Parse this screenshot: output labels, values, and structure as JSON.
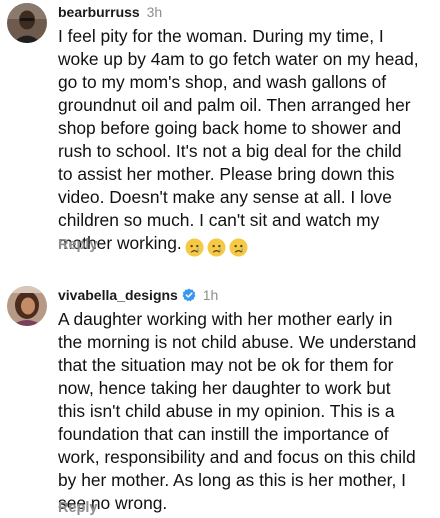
{
  "comments": [
    {
      "username": "bearburruss",
      "time": "3h",
      "verified": false,
      "text": "I feel pity for the woman. During my time, I\nwoke up by 4am to go fetch water on my head,\ngo to my mom's shop, and wash gallons of\ngroundnut oil and palm oil. Then arranged her\nshop before going back home to shower and\nrush to school. It's not a big deal for the child\nto assist her mother. Please bring down this\nvideo. Doesn't make any sense at all. I love\nchildren so much. I can't sit and watch my\nmother working.",
      "emojis": [
        "crying-face",
        "crying-face",
        "crying-face"
      ],
      "reply_label": "Reply"
    },
    {
      "username": "vivabella_designs",
      "time": "1h",
      "verified": true,
      "text": "A daughter working with her mother early in\nthe morning is not child abuse. We understand\nthat the situation may not be ok for them for\nnow, hence taking her daughter to work but\nthis isn't child abuse in my opinion. This is a\nfoundation that can instill the importance of\nwork, responsibility and and focus on this child\nby her mother. As long as this is her mother, I\nsee no wrong.",
      "emojis": [],
      "reply_label": "Reply"
    }
  ],
  "colors": {
    "verified_badge": "#3897f0",
    "secondary_text": "#8e8e8e"
  }
}
